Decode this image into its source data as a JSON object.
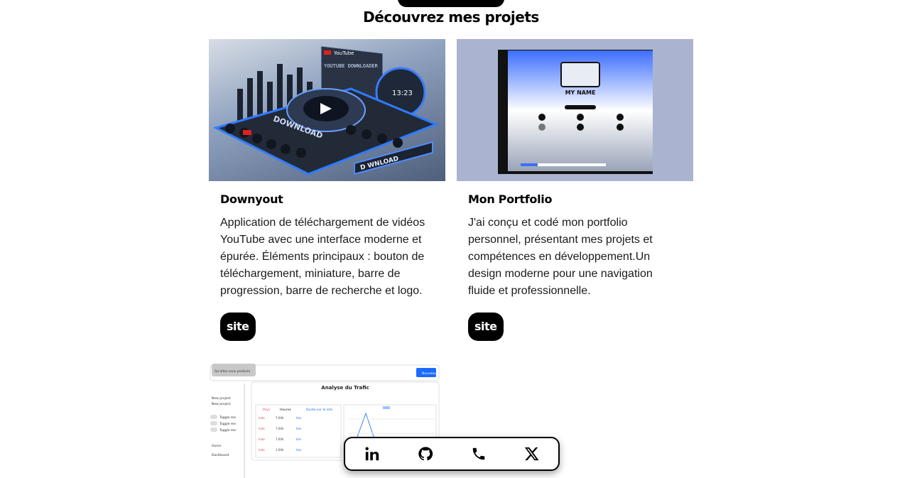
{
  "section": {
    "title": "Découvrez mes projets"
  },
  "projects": [
    {
      "title": "Downyout",
      "description": "Application de téléchargement de vidéos YouTube avec une interface moderne et épurée. Éléments principaux : bouton de téléchargement, miniature, barre de progression, barre de recherche et logo.",
      "button_label": "site",
      "thumbnail": {
        "brand": "YouTube",
        "heading": "YOUTUBE DOWNLOADER",
        "timer": "13:23",
        "download_text": "DOWNLOAD",
        "strip_text": "D    WNLOAD"
      }
    },
    {
      "title": "Mon Portfolio",
      "description": "J'ai conçu et codé mon portfolio personnel, présentant mes projets et compétences en développement.Un design moderne pour une navigation fluide et professionnelle.",
      "button_label": "site",
      "thumbnail": {
        "name": "MY NAME"
      }
    },
    {
      "thumbnail": {
        "search_placeholder": "Qu'allez-vous produire",
        "button": "Nouveau",
        "chart_title": "Analyse du Trafic",
        "menu": [
          "New project",
          "New project"
        ],
        "toggles": [
          "Toggle me",
          "Toggle me",
          "Toggle me"
        ],
        "nav": [
          "Home",
          "Dashboard"
        ],
        "table_headers": [
          "Pays",
          "Heures",
          "Durée sur le site"
        ],
        "rows": [
          [
            "Inde",
            "7:00h",
            "lien"
          ],
          [
            "Inde",
            "7:00h",
            "lien"
          ],
          [
            "Inde",
            "7:00h",
            "lien"
          ],
          [
            "Inde",
            "1:00h",
            "lien"
          ]
        ]
      }
    }
  ],
  "dock": [
    {
      "icon": "linkedin-icon"
    },
    {
      "icon": "github-icon"
    },
    {
      "icon": "phone-icon"
    },
    {
      "icon": "x-icon"
    }
  ]
}
